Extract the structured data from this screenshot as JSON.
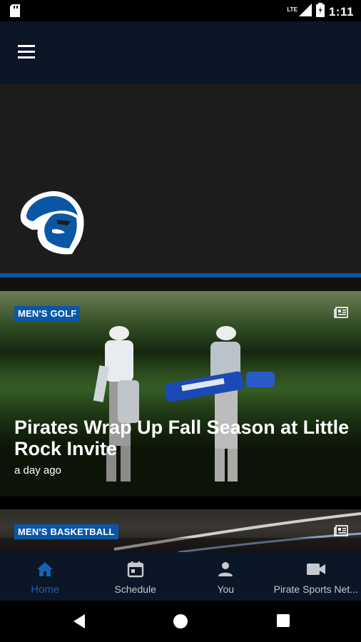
{
  "status_bar": {
    "time": "1:11",
    "network": "LTE"
  },
  "app_bar": {
    "menu_icon": "hamburger-menu-icon"
  },
  "hero": {
    "logo": "seton-hall-pirate-logo",
    "accent_color": "#0a57a6"
  },
  "stories": [
    {
      "tag": "MEN'S GOLF",
      "headline": "Pirates Wrap Up Fall Season at Little Rock Invite",
      "timestamp": "a day ago",
      "type_icon": "news-article-icon"
    },
    {
      "tag": "MEN'S BASKETBALL",
      "type_icon": "news-article-icon"
    }
  ],
  "bottom_nav": {
    "items": [
      {
        "label": "Home",
        "icon": "home-icon",
        "active": true
      },
      {
        "label": "Schedule",
        "icon": "calendar-icon",
        "active": false
      },
      {
        "label": "You",
        "icon": "person-icon",
        "active": false
      },
      {
        "label": "Pirate Sports Net...",
        "icon": "video-camera-icon",
        "active": false
      }
    ],
    "active_color": "#1760b2"
  }
}
